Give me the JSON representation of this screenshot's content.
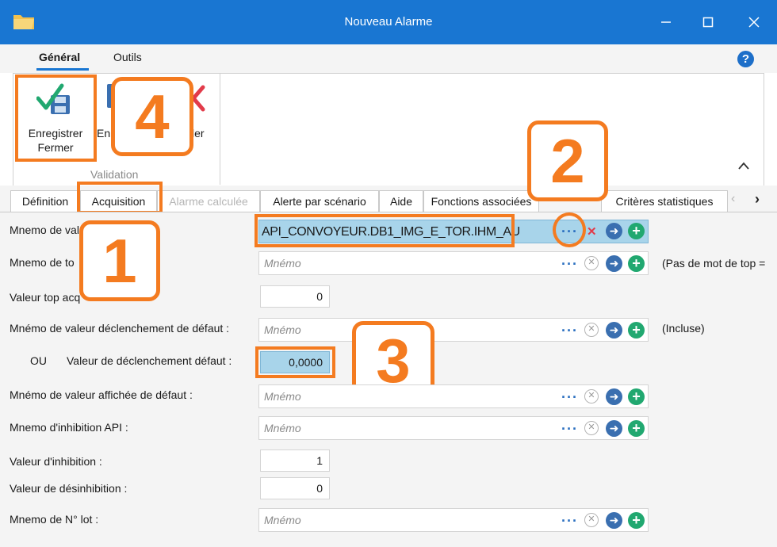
{
  "window": {
    "title": "Nouveau Alarme"
  },
  "ribbon_tabs": [
    "Général",
    "Outils"
  ],
  "ribbon": {
    "buttons": [
      "Enregistrer\nFermer",
      "Enregistrer",
      "Annuler"
    ],
    "save_close_l1": "Enregistrer",
    "save_close_l2": "Fermer",
    "save_partial": "Enr",
    "cancel_partial": "ler",
    "group_label": "Validation"
  },
  "tabs": [
    {
      "label": "Définition"
    },
    {
      "label": "Acquisition",
      "active": true
    },
    {
      "label": "Alarme calculée",
      "disabled": true
    },
    {
      "label": "Alerte par scénario"
    },
    {
      "label": "Aide"
    },
    {
      "label": "Fonctions associées"
    },
    {
      "label": "Critères statistiques"
    }
  ],
  "form": {
    "mnemo_valeur_label": "Mnemo de val",
    "mnemo_valeur_value": "API_CONVOYEUR.DB1_IMG_E_TOR.IHM_AU",
    "mnemo_top_label": "Mnemo de to",
    "mnemo_top_placeholder": "Mnémo",
    "mnemo_top_note": "(Pas de mot de top =",
    "valeur_top_label": "Valeur top acq",
    "valeur_top_value": "0",
    "mnemo_decl_label": "Mnémo de valeur déclenchement de défaut :",
    "mnemo_decl_placeholder": "Mnémo",
    "mnemo_decl_note": "(Incluse)",
    "ou_label": "OU",
    "valeur_decl_label": "Valeur de déclenchement défaut :",
    "valeur_decl_value": "0,0000",
    "mnemo_aff_label": "Mnémo de valeur affichée de défaut :",
    "mnemo_aff_placeholder": "Mnémo",
    "mnemo_inhib_label": "Mnemo d'inhibition API :",
    "mnemo_inhib_placeholder": "Mnémo",
    "valeur_inhib_label": "Valeur d'inhibition :",
    "valeur_inhib_value": "1",
    "valeur_desinhib_label": "Valeur de désinhibition :",
    "valeur_desinhib_value": "0",
    "mnemo_lot_label": "Mnemo de N° lot :",
    "mnemo_lot_placeholder": "Mnémo"
  },
  "callouts": [
    "1",
    "2",
    "3",
    "4"
  ],
  "colors": {
    "titlebar": "#1976d2",
    "callout": "#f47b20",
    "highlight_field": "#a8d4ea"
  }
}
